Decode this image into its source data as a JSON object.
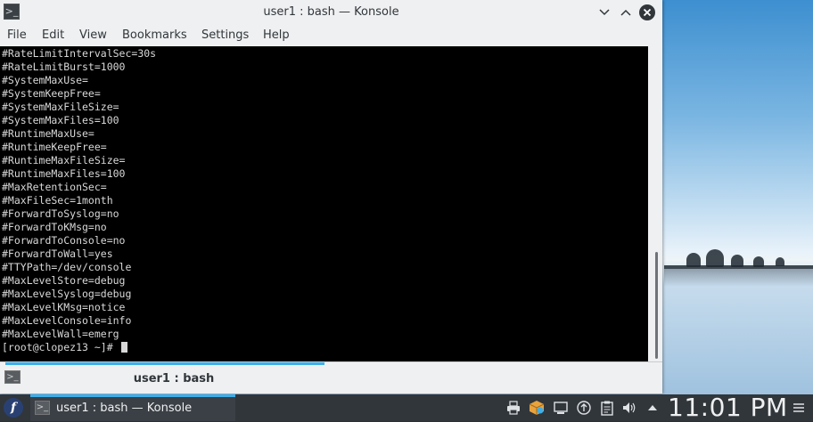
{
  "window": {
    "title": "user1 : bash — Konsole",
    "minimize_icon": "chevron-down-icon",
    "maximize_icon": "chevron-up-icon",
    "close_icon": "close-icon"
  },
  "menubar": {
    "items": [
      "File",
      "Edit",
      "View",
      "Bookmarks",
      "Settings",
      "Help"
    ]
  },
  "terminal": {
    "lines": [
      "#RateLimitIntervalSec=30s",
      "#RateLimitBurst=1000",
      "#SystemMaxUse=",
      "#SystemKeepFree=",
      "#SystemMaxFileSize=",
      "#SystemMaxFiles=100",
      "#RuntimeMaxUse=",
      "#RuntimeKeepFree=",
      "#RuntimeMaxFileSize=",
      "#RuntimeMaxFiles=100",
      "#MaxRetentionSec=",
      "#MaxFileSec=1month",
      "#ForwardToSyslog=no",
      "#ForwardToKMsg=no",
      "#ForwardToConsole=no",
      "#ForwardToWall=yes",
      "#TTYPath=/dev/console",
      "#MaxLevelStore=debug",
      "#MaxLevelSyslog=debug",
      "#MaxLevelKMsg=notice",
      "#MaxLevelConsole=info",
      "#MaxLevelWall=emerg"
    ],
    "prompt": "[root@clopez13 ~]# "
  },
  "tabs": [
    {
      "label": "user1 : bash",
      "active": true
    }
  ],
  "taskbar": {
    "task_label": "user1 : bash — Konsole",
    "clock": "11:01 PM",
    "accent": "#3daee9"
  }
}
